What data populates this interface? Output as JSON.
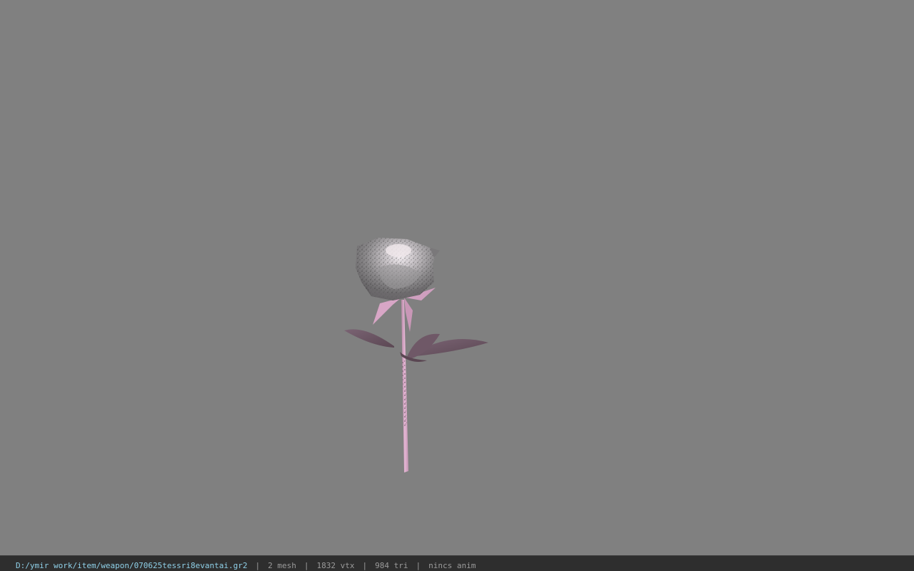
{
  "status": {
    "path": "D:/ymir work/item/weapon/070625tessri8evantai.gr2",
    "mesh": "2 mesh",
    "vtx": "1832 vtx",
    "tri": "984 tri",
    "anim": "nincs anim",
    "separator": "|"
  },
  "colors": {
    "background": "#808080",
    "statusbar": "#2e2e2e",
    "path_text": "#8fd0e8",
    "info_text": "#9a9a9a",
    "stem": "#d9a6c8",
    "leaf": "#6b5563",
    "petal": "#8a8a8a"
  }
}
